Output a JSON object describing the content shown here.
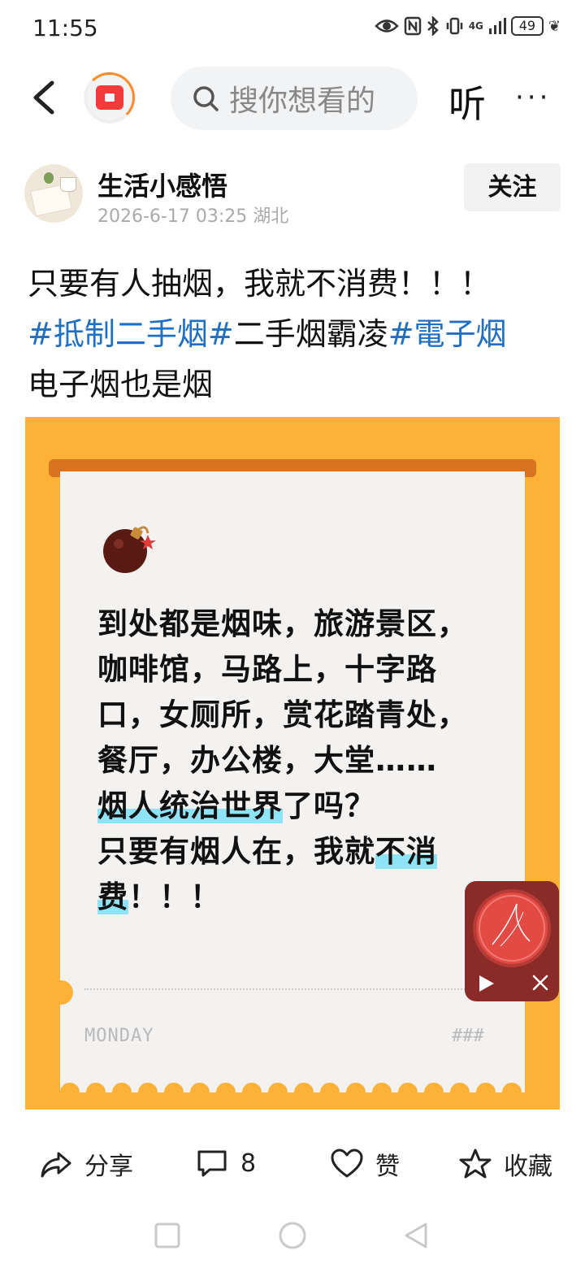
{
  "status_bar": {
    "time": "11:55",
    "network": "4G",
    "battery": "49"
  },
  "nav": {
    "search_placeholder": "搜你想看的",
    "listen_label": "听",
    "more_label": "···"
  },
  "author": {
    "name": "生活小感悟",
    "meta": "2026-6-17 03:25  湖北",
    "follow_label": "关注"
  },
  "post": {
    "line1": "只要有人抽烟，我就不消费！！！",
    "tag1": "#抵制二手烟#",
    "plain1": "二手烟霸凌",
    "tag2": "#電子烟",
    "line3": "电子烟也是烟"
  },
  "card": {
    "line1": "到处都是烟味，旅游景区，",
    "line2": "咖啡馆，马路上，十字路",
    "line3": "口，女厕所，赏花踏青处，",
    "line4": "餐厅，办公楼，大堂……",
    "line5_hl": "烟人统治世界",
    "line5_rest": "了吗？",
    "line6_a": "只要有烟人在，我就",
    "line6_hl": "不消",
    "line7_hl": "费",
    "line7_rest": "！！！",
    "footer_left": "MONDAY",
    "footer_right": "###"
  },
  "actions": {
    "share_label": "分享",
    "comment_count": "8",
    "like_label": "赞",
    "favorite_label": "收藏"
  },
  "colors": {
    "tag": "#1f6fc5",
    "card_bg": "#fdb237",
    "highlight": "#8fe3f6",
    "player_bg": "#8a2b28"
  }
}
